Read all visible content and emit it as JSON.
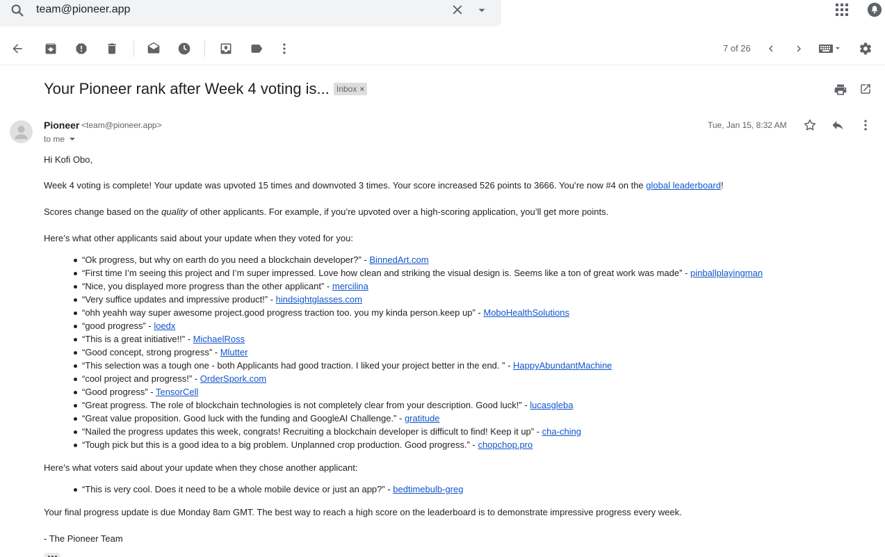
{
  "search": {
    "query": "team@pioneer.app"
  },
  "toolbar": {
    "pager": "7 of 26"
  },
  "email": {
    "subject": "Your Pioneer rank after Week 4 voting is...",
    "label": "Inbox",
    "sender_name": "Pioneer",
    "sender_email": "<team@pioneer.app>",
    "to": "to me",
    "date": "Tue, Jan 15, 8:32 AM",
    "greeting": "Hi Kofi Obo,",
    "p1_text": "Week 4 voting is complete! Your update was upvoted 15 times and downvoted 3 times. Your score increased 526 points to 3666. You’re now #4 on the ",
    "p1_link": "global leaderboard",
    "p1_end": "!",
    "p2_a": "Scores change based on the ",
    "p2_em": "quality",
    "p2_b": " of other applicants. For example, if you’re upvoted over a high-scoring application, you’ll get more points.",
    "p3": "Here’s what other applicants said about your update when they voted for you:",
    "comments_for": [
      {
        "text": "“Ok progress, but why on earth do you need a blockchain developer?” - ",
        "author": "BinnedArt.com"
      },
      {
        "text": "“First time I’m seeing this project and I’m super impressed. Love how clean and striking the visual design is. Seems like a ton of great work was made” - ",
        "author": "pinballplayingman"
      },
      {
        "text": "“Nice, you displayed more progress than the other applicant” - ",
        "author": "mercilina"
      },
      {
        "text": "“Very suffice updates and impressive product!” - ",
        "author": "hindsightglasses.com"
      },
      {
        "text": "“ohh yeahh way super awesome project.good progress traction too. you my kinda person.keep up” - ",
        "author": "MoboHealthSolutions"
      },
      {
        "text": "“good progress” - ",
        "author": "loedx"
      },
      {
        "text": "“This is a great initiative!!” - ",
        "author": "MichaelRoss"
      },
      {
        "text": "“Good concept, strong progress” - ",
        "author": "Mlutter"
      },
      {
        "text": "“This selection was a tough one - both Applicants had good traction. I liked your project better in the end. ” - ",
        "author": "HappyAbundantMachine"
      },
      {
        "text": "“cool project and progress!” - ",
        "author": "OrderSpork.com"
      },
      {
        "text": "“Good progress” - ",
        "author": "TensorCell"
      },
      {
        "text": "“Great progress. The role of blockchain technologies is not completely clear from your description. Good luck!” - ",
        "author": "lucasgleba"
      },
      {
        "text": "“Great value proposition. Good luck with the funding and GoogleAI Challenge.” - ",
        "author": "gratitude"
      },
      {
        "text": "“Nailed the progress updates this week, congrats! Recruiting a blockchain developer is difficult to find! Keep it up” - ",
        "author": "cha-ching"
      },
      {
        "text": "“Tough pick but this is a good idea to a big problem. Unplanned crop production. Good progress.” - ",
        "author": "chopchop.pro"
      }
    ],
    "p4": "Here’s what voters said about your update when they chose another applicant:",
    "comments_against": [
      {
        "text": "“This is very cool. Does it need to be a whole mobile device or just an app?” - ",
        "author": "bedtimebulb-greg"
      }
    ],
    "p5": "Your final progress update is due Monday 8am GMT. The best way to reach a high score on the leaderboard is to demonstrate impressive progress every week.",
    "signoff": "- The Pioneer Team"
  }
}
